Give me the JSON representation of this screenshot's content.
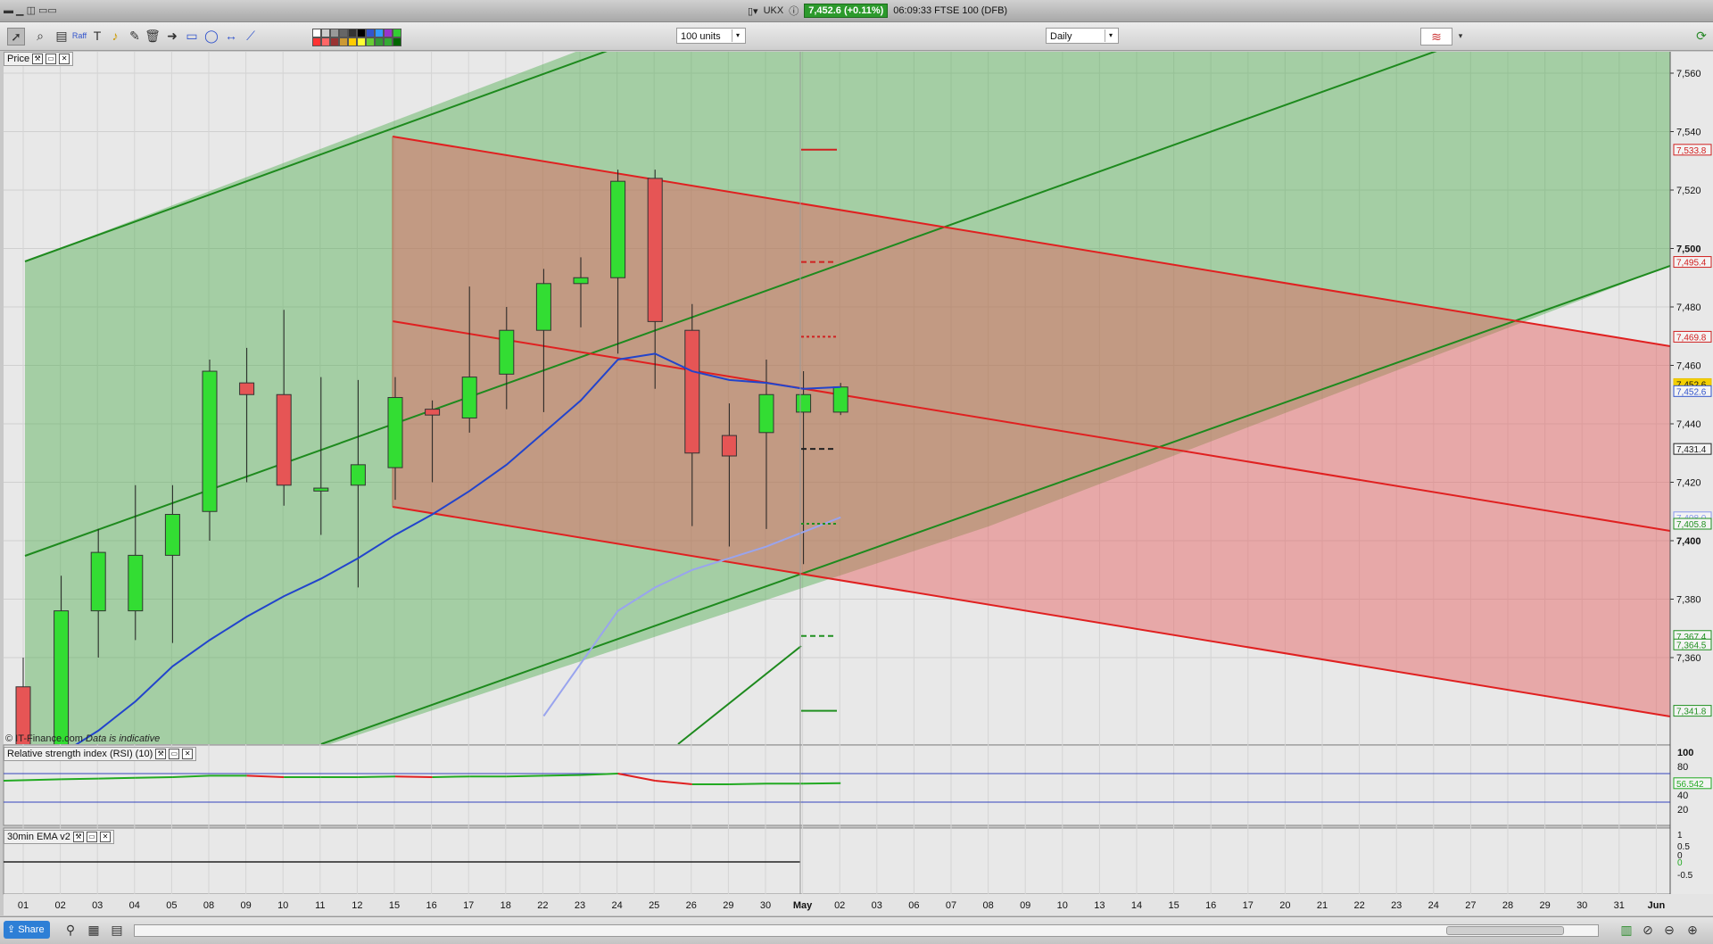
{
  "titlebar": {
    "symbol": "UKX",
    "price_badge": "7,452.6 (+0.11%)",
    "time_desc": "06:09:33 FTSE 100 (DFB)"
  },
  "toolbar": {
    "units_value": "100 units",
    "interval_value": "Daily",
    "tool_icons": [
      "pointer-icon",
      "zoom-icon",
      "fib-icon",
      "text-icon",
      "alert-icon",
      "eraser-icon",
      "trash-icon",
      "arrow-icon",
      "rect-icon",
      "ellipse-icon",
      "hline-icon",
      "trendline-icon"
    ],
    "swatch_colors": [
      "#ffffff",
      "#cccccc",
      "#999999",
      "#666666",
      "#333333",
      "#000000",
      "#3355cc",
      "#3399ff",
      "#9933cc",
      "#33cc33",
      "#ff3333",
      "#ff6666",
      "#993333",
      "#cc9933",
      "#ffcc00",
      "#ffff33",
      "#66cc33",
      "#339933",
      "#33aa33",
      "#006600"
    ]
  },
  "panels": {
    "price_label": "Price",
    "rsi_label": "Relative strength index (RSI) (10)",
    "ema_label": "30min EMA v2",
    "copyright": "© IT-Finance.com",
    "disclaimer": "Data is indicative"
  },
  "chart_data": {
    "type": "candlestick",
    "title": "",
    "price_axis": {
      "ylim": [
        7330,
        7568
      ],
      "ticks": [
        7360,
        7380,
        7400,
        7420,
        7440,
        7460,
        7480,
        7500,
        7520,
        7540,
        7560
      ]
    },
    "date_ticks": [
      "01",
      "02",
      "03",
      "04",
      "05",
      "08",
      "09",
      "10",
      "11",
      "12",
      "15",
      "16",
      "17",
      "18",
      "22",
      "23",
      "24",
      "25",
      "26",
      "29",
      "30",
      "May",
      "02",
      "03",
      "06",
      "07",
      "08",
      "09",
      "10",
      "13",
      "14",
      "15",
      "16",
      "17",
      "20",
      "21",
      "22",
      "23",
      "24",
      "27",
      "28",
      "29",
      "30",
      "31",
      "Jun"
    ],
    "candles": [
      {
        "d": "29",
        "o": 7350,
        "h": 7360,
        "l": 7320,
        "c": 7330
      },
      {
        "d": "01",
        "o": 7305,
        "h": 7388,
        "l": 7300,
        "c": 7376
      },
      {
        "d": "02",
        "o": 7376,
        "h": 7404,
        "l": 7360,
        "c": 7396
      },
      {
        "d": "03",
        "o": 7376,
        "h": 7419,
        "l": 7366,
        "c": 7395
      },
      {
        "d": "04",
        "o": 7395,
        "h": 7419,
        "l": 7365,
        "c": 7409
      },
      {
        "d": "05",
        "o": 7410,
        "h": 7462,
        "l": 7400,
        "c": 7458
      },
      {
        "d": "08",
        "o": 7454,
        "h": 7466,
        "l": 7420,
        "c": 7450
      },
      {
        "d": "09",
        "o": 7450,
        "h": 7479,
        "l": 7412,
        "c": 7419
      },
      {
        "d": "10",
        "o": 7417,
        "h": 7456,
        "l": 7402,
        "c": 7418
      },
      {
        "d": "11",
        "o": 7419,
        "h": 7455,
        "l": 7384,
        "c": 7426
      },
      {
        "d": "12",
        "o": 7425,
        "h": 7456,
        "l": 7414,
        "c": 7449
      },
      {
        "d": "15",
        "o": 7445,
        "h": 7448,
        "l": 7420,
        "c": 7443
      },
      {
        "d": "16",
        "o": 7442,
        "h": 7487,
        "l": 7437,
        "c": 7456
      },
      {
        "d": "17",
        "o": 7457,
        "h": 7480,
        "l": 7445,
        "c": 7472
      },
      {
        "d": "18",
        "o": 7472,
        "h": 7493,
        "l": 7444,
        "c": 7488
      },
      {
        "d": "22",
        "o": 7488,
        "h": 7497,
        "l": 7473,
        "c": 7490
      },
      {
        "d": "23",
        "o": 7490,
        "h": 7527,
        "l": 7464,
        "c": 7523
      },
      {
        "d": "24",
        "o": 7524,
        "h": 7527,
        "l": 7452,
        "c": 7475
      },
      {
        "d": "25",
        "o": 7472,
        "h": 7481,
        "l": 7405,
        "c": 7430
      },
      {
        "d": "26",
        "o": 7436,
        "h": 7447,
        "l": 7398,
        "c": 7429
      },
      {
        "d": "29",
        "o": 7437,
        "h": 7462,
        "l": 7404,
        "c": 7450
      },
      {
        "d": "30",
        "o": 7444,
        "h": 7458,
        "l": 7392,
        "c": 7450
      },
      {
        "d": "May",
        "o": 7444,
        "h": 7454,
        "l": 7443,
        "c": 7452.6
      }
    ],
    "ema_fast": [
      7327,
      7335,
      7345,
      7357,
      7366,
      7374,
      7381,
      7387,
      7394,
      7402,
      7409,
      7417,
      7426,
      7437,
      7448,
      7462,
      7464,
      7458,
      7455,
      7454,
      7452,
      7452.6
    ],
    "ema_slow": [
      7340,
      7358,
      7376,
      7384,
      7390,
      7394,
      7398,
      7403,
      7408
    ],
    "right_labels": [
      {
        "text": "7,533.8",
        "price": 7533.8,
        "color": "#d02020"
      },
      {
        "text": "7,495.4",
        "price": 7495.4,
        "color": "#d02020"
      },
      {
        "text": "7,469.8",
        "price": 7469.8,
        "color": "#d02020"
      },
      {
        "text": "7,452.6",
        "price": 7453.6,
        "color": "#e8c000"
      },
      {
        "text": "7,452.6",
        "price": 7451.2,
        "color": "#3355cc"
      },
      {
        "text": "7,431.4",
        "price": 7431.4,
        "color": "#222222"
      },
      {
        "text": "7,408.0",
        "price": 7408.0,
        "color": "#8899ee"
      },
      {
        "text": "7,405.8",
        "price": 7405.8,
        "color": "#209020"
      },
      {
        "text": "7,367.4",
        "price": 7367.4,
        "color": "#209020"
      },
      {
        "text": "7,364.5",
        "price": 7364.5,
        "color": "#209020"
      },
      {
        "text": "7,341.8",
        "price": 7341.8,
        "color": "#209020"
      }
    ],
    "pivot_levels": [
      {
        "price": 7533.8,
        "style": "solid",
        "color": "#d02020"
      },
      {
        "price": 7495.4,
        "style": "dashed",
        "color": "#d02020"
      },
      {
        "price": 7469.8,
        "style": "dotted",
        "color": "#d02020"
      },
      {
        "price": 7431.4,
        "style": "dashed",
        "color": "#222222"
      },
      {
        "price": 7405.8,
        "style": "dotted",
        "color": "#209020"
      },
      {
        "price": 7367.4,
        "style": "dashed",
        "color": "#209020"
      },
      {
        "price": 7341.8,
        "style": "solid",
        "color": "#209020"
      }
    ],
    "rsi": {
      "ticks": [
        "100",
        "80",
        "40",
        "20"
      ],
      "value_label": "56.542",
      "levels": [
        70,
        30
      ],
      "values": [
        60,
        62,
        63,
        64,
        65,
        67,
        67,
        65,
        65,
        65,
        66,
        65,
        66,
        66,
        67,
        68,
        70,
        60,
        55,
        55,
        56,
        56,
        56.5
      ]
    },
    "ema_panel": {
      "ticks": [
        "1",
        "0.5",
        "0",
        "0",
        "-0.5"
      ]
    }
  },
  "bottom": {
    "share_label": "Share"
  }
}
